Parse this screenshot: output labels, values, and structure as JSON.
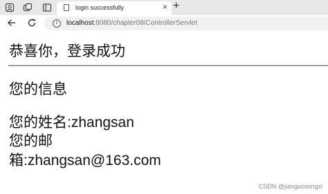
{
  "tab": {
    "title": "login successfully",
    "close_label": "×"
  },
  "new_tab_label": "+",
  "address": {
    "host": "localhost",
    "path": ":8080/chapter08/ControllerServlet"
  },
  "page": {
    "heading": "恭喜你，登录成功",
    "subheading": "您的信息",
    "name_line": "您的姓名:zhangsan",
    "email_line_1": "您的邮",
    "email_line_2": "箱:zhangsan@163.com"
  },
  "watermark": "CSDN @jianguosongzi",
  "icons": {
    "profile": "profile-icon",
    "workspaces": "workspaces-icon",
    "tab_actions": "tab-actions-icon",
    "back": "back-arrow-icon",
    "reload": "reload-icon",
    "site_info": "info-icon"
  }
}
